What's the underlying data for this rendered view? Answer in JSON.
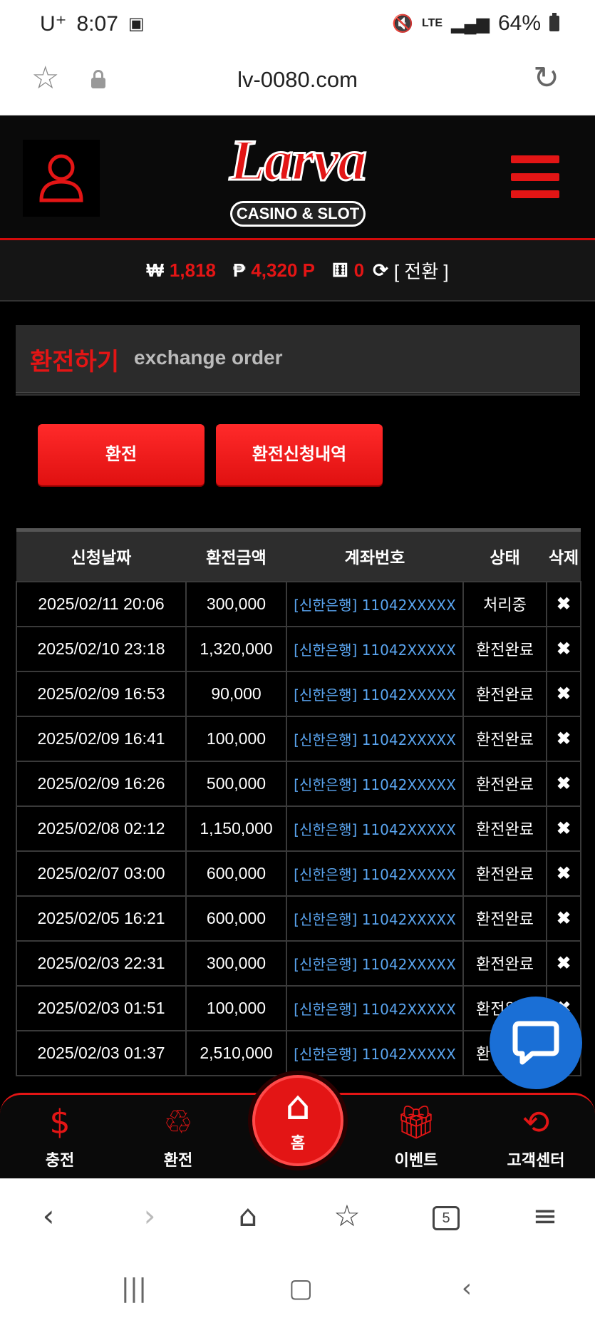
{
  "status_bar": {
    "carrier": "U⁺",
    "time": "8:07",
    "network": "LTE",
    "battery": "64%"
  },
  "browser": {
    "url": "lv-0080.com",
    "tabs_count": "5"
  },
  "site": {
    "logo_main": "Larva",
    "logo_sub": "CASINO & SLOT",
    "accent_color": "#e31515"
  },
  "balance": {
    "won_symbol": "₩",
    "won_value": "1,818",
    "point_symbol": "₱",
    "point_value": "4,320 P",
    "chip_value": "0",
    "swap_label": "[ 전환 ]"
  },
  "page": {
    "title_kr": "환전하기",
    "title_en": "exchange order",
    "btn_exchange": "환전",
    "btn_history": "환전신청내역"
  },
  "table": {
    "headers": [
      "신청날짜",
      "환전금액",
      "계좌번호",
      "상태",
      "삭제"
    ],
    "rows": [
      {
        "date": "2025/02/11 20:06",
        "amount": "300,000",
        "account": "[신한은행] 11042XXXXX",
        "status": "처리중",
        "del": "✖"
      },
      {
        "date": "2025/02/10 23:18",
        "amount": "1,320,000",
        "account": "[신한은행] 11042XXXXX",
        "status": "환전완료",
        "del": "✖"
      },
      {
        "date": "2025/02/09 16:53",
        "amount": "90,000",
        "account": "[신한은행] 11042XXXXX",
        "status": "환전완료",
        "del": "✖"
      },
      {
        "date": "2025/02/09 16:41",
        "amount": "100,000",
        "account": "[신한은행] 11042XXXXX",
        "status": "환전완료",
        "del": "✖"
      },
      {
        "date": "2025/02/09 16:26",
        "amount": "500,000",
        "account": "[신한은행] 11042XXXXX",
        "status": "환전완료",
        "del": "✖"
      },
      {
        "date": "2025/02/08 02:12",
        "amount": "1,150,000",
        "account": "[신한은행] 11042XXXXX",
        "status": "환전완료",
        "del": "✖"
      },
      {
        "date": "2025/02/07 03:00",
        "amount": "600,000",
        "account": "[신한은행] 11042XXXXX",
        "status": "환전완료",
        "del": "✖"
      },
      {
        "date": "2025/02/05 16:21",
        "amount": "600,000",
        "account": "[신한은행] 11042XXXXX",
        "status": "환전완료",
        "del": "✖"
      },
      {
        "date": "2025/02/03 22:31",
        "amount": "300,000",
        "account": "[신한은행] 11042XXXXX",
        "status": "환전완료",
        "del": "✖"
      },
      {
        "date": "2025/02/03 01:51",
        "amount": "100,000",
        "account": "[신한은행] 11042XXXXX",
        "status": "환전완료",
        "del": "✖"
      },
      {
        "date": "2025/02/03 01:37",
        "amount": "2,510,000",
        "account": "[신한은행] 11042XXXXX",
        "status": "환전완료",
        "del": "✖"
      }
    ]
  },
  "bottom_nav": {
    "deposit": "충전",
    "withdraw": "환전",
    "home": "홈",
    "event": "이벤트",
    "support": "고객센터"
  }
}
